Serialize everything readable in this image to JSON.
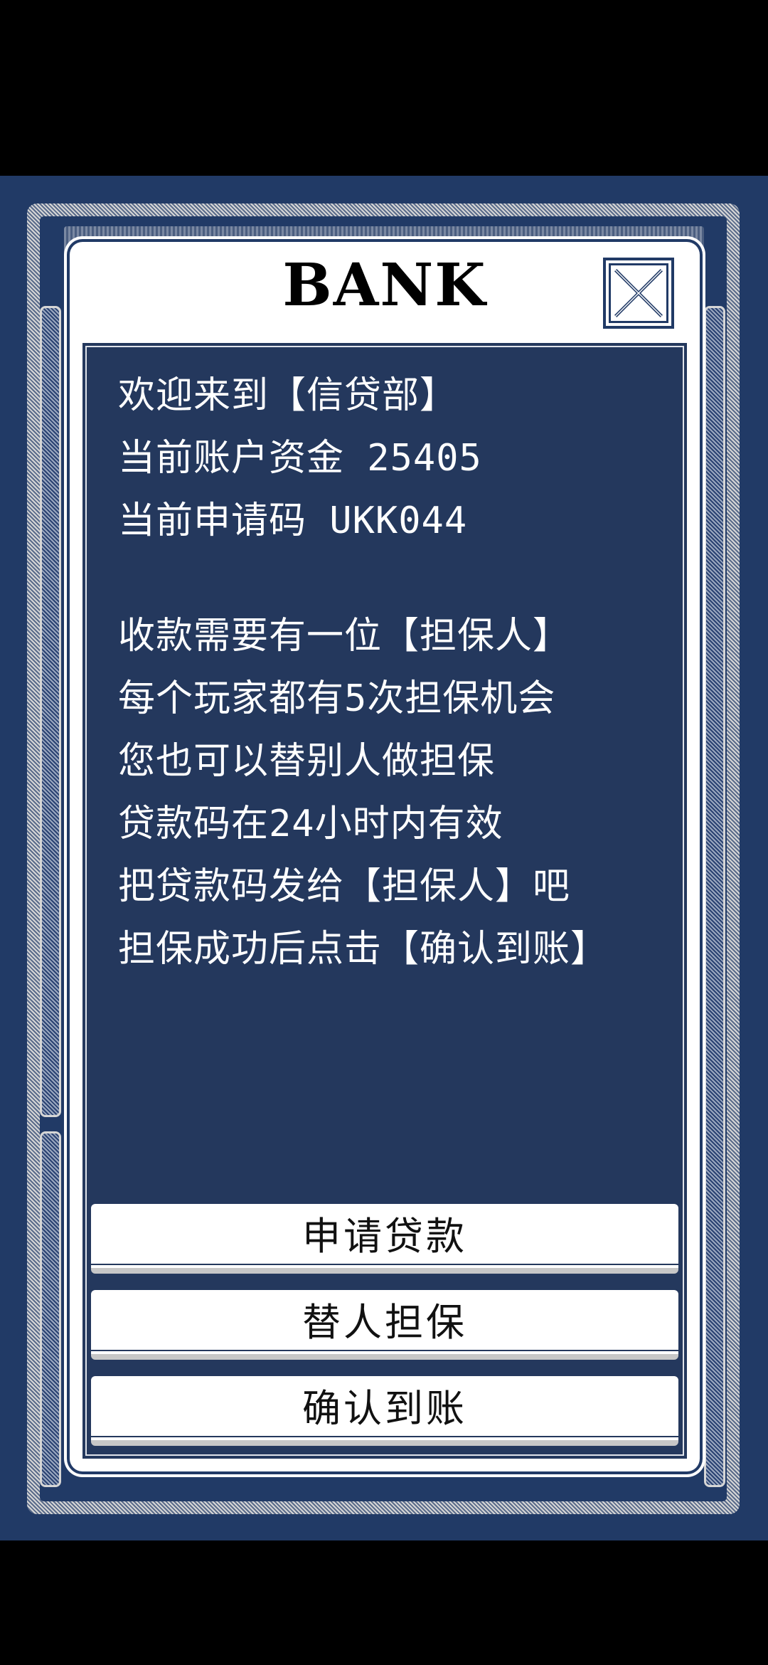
{
  "dialog": {
    "title": "BANK",
    "close_icon": "close-x-icon"
  },
  "message": {
    "lines_top": [
      "欢迎来到【信贷部】",
      "当前账户资金 25405",
      "当前申请码 UKK044"
    ],
    "lines_bottom": [
      "收款需要有一位【担保人】",
      "每个玩家都有5次担保机会",
      "您也可以替别人做担保",
      "贷款码在24小时内有效",
      "把贷款码发给【担保人】吧",
      "担保成功后点击【确认到账】"
    ]
  },
  "buttons": {
    "apply_loan": "申请贷款",
    "guarantee_others": "替人担保",
    "confirm_receipt": "确认到账"
  },
  "colors": {
    "background": "#213a66",
    "panel": "#24385d",
    "dialog": "#ffffff",
    "text_on_panel": "#ffffff",
    "button_text": "#111111"
  }
}
